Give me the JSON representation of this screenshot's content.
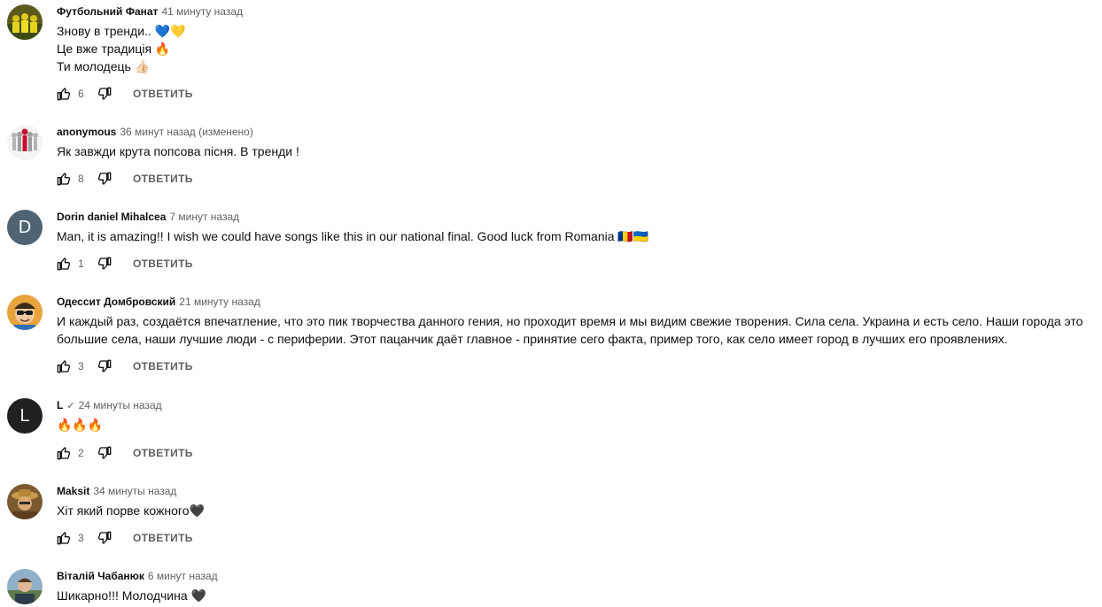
{
  "reply_label": "ОТВЕТИТЬ",
  "comments": [
    {
      "author": "Футбольний Фанат",
      "time": "41 минуту назад",
      "lines": [
        "Знову в тренди.. 💙💛",
        "Це вже традиція 🔥",
        "Ти молодець 👍🏻"
      ],
      "likes": "6",
      "avatar": "yellow-team-photo"
    },
    {
      "author": "anonymous",
      "time": "36 минут назад (изменено)",
      "lines": [
        "Як завжди крута попсова пісня.  В тренди !"
      ],
      "likes": "8",
      "avatar": "red-figure-among-grey"
    },
    {
      "author": "Dorin daniel Mihalcea",
      "time": "7 минут назад",
      "lines": [
        "Man, it is amazing!! I wish we could have songs like this in our national final. Good luck from Romania 🇷🇴🇺🇦"
      ],
      "likes": "1",
      "avatar_letter": "D",
      "avatar_color": "#4f6373"
    },
    {
      "author": "Одессит Домбровский",
      "time": "21 минуту назад",
      "lines": [
        "И каждый раз, создаётся впечатление, что это пик творчества данного гения, но проходит время и мы видим свежие творения. Сила села. Украина и есть село. Наши города это",
        "большие села, наши лучшие люди - с периферии. Этот пацанчик даёт главное - принятие сего факта, пример того, как село имеет город в лучших его проявлениях."
      ],
      "likes": "3",
      "avatar": "cartoon-man-sunglasses"
    },
    {
      "author": "L",
      "verified": "✓",
      "time": "24 минуты назад",
      "lines": [
        "🔥🔥🔥"
      ],
      "likes": "2",
      "avatar_letter": "L",
      "avatar_color": "#212121"
    },
    {
      "author": "Maksit",
      "time": "34 минуты назад",
      "lines": [
        "Хіт який порве кожного🖤"
      ],
      "likes": "3",
      "avatar": "man-with-hat"
    },
    {
      "author": "Віталій Чабанюк",
      "time": "6 минут назад",
      "lines": [
        "Шикарно!!! Молодчина 🖤"
      ],
      "likes": "",
      "avatar": "man-portrait-outdoor"
    }
  ]
}
